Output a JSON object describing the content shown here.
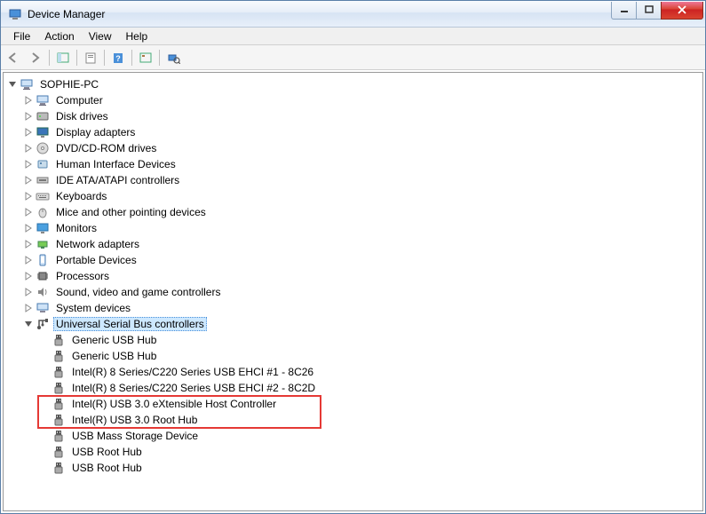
{
  "window": {
    "title": "Device Manager"
  },
  "menu": {
    "file": "File",
    "action": "Action",
    "view": "View",
    "help": "Help"
  },
  "toolbar_icons": [
    "back",
    "forward",
    "sep",
    "show-hide-tree",
    "sep",
    "properties",
    "sep",
    "help",
    "sep",
    "action-prop",
    "sep",
    "scan-hardware"
  ],
  "tree": {
    "root": {
      "label": "SOPHIE-PC",
      "icon": "computer",
      "expanded": true
    },
    "categories": [
      {
        "label": "Computer",
        "icon": "computer",
        "expanded": false
      },
      {
        "label": "Disk drives",
        "icon": "disk",
        "expanded": false
      },
      {
        "label": "Display adapters",
        "icon": "display",
        "expanded": false
      },
      {
        "label": "DVD/CD-ROM drives",
        "icon": "dvd",
        "expanded": false
      },
      {
        "label": "Human Interface Devices",
        "icon": "hid",
        "expanded": false
      },
      {
        "label": "IDE ATA/ATAPI controllers",
        "icon": "ide",
        "expanded": false
      },
      {
        "label": "Keyboards",
        "icon": "keyboard",
        "expanded": false
      },
      {
        "label": "Mice and other pointing devices",
        "icon": "mouse",
        "expanded": false
      },
      {
        "label": "Monitors",
        "icon": "monitor",
        "expanded": false
      },
      {
        "label": "Network adapters",
        "icon": "network",
        "expanded": false
      },
      {
        "label": "Portable Devices",
        "icon": "portable",
        "expanded": false
      },
      {
        "label": "Processors",
        "icon": "processor",
        "expanded": false
      },
      {
        "label": "Sound, video and game controllers",
        "icon": "sound",
        "expanded": false
      },
      {
        "label": "System devices",
        "icon": "system",
        "expanded": false
      },
      {
        "label": "Universal Serial Bus controllers",
        "icon": "usb",
        "expanded": true,
        "selected": true,
        "children": [
          {
            "label": "Generic USB Hub",
            "icon": "usb-device"
          },
          {
            "label": "Generic USB Hub",
            "icon": "usb-device"
          },
          {
            "label": "Intel(R) 8 Series/C220 Series USB EHCI #1 - 8C26",
            "icon": "usb-device"
          },
          {
            "label": "Intel(R) 8 Series/C220 Series USB EHCI #2 - 8C2D",
            "icon": "usb-device"
          },
          {
            "label": "Intel(R) USB 3.0 eXtensible Host Controller",
            "icon": "usb-device",
            "highlight": true
          },
          {
            "label": "Intel(R) USB 3.0 Root Hub",
            "icon": "usb-device",
            "highlight": true
          },
          {
            "label": "USB Mass Storage Device",
            "icon": "usb-device"
          },
          {
            "label": "USB Root Hub",
            "icon": "usb-device"
          },
          {
            "label": "USB Root Hub",
            "icon": "usb-device"
          }
        ]
      }
    ]
  },
  "colors": {
    "highlight_border": "#e53935",
    "selection_bg": "#cde8ff"
  }
}
